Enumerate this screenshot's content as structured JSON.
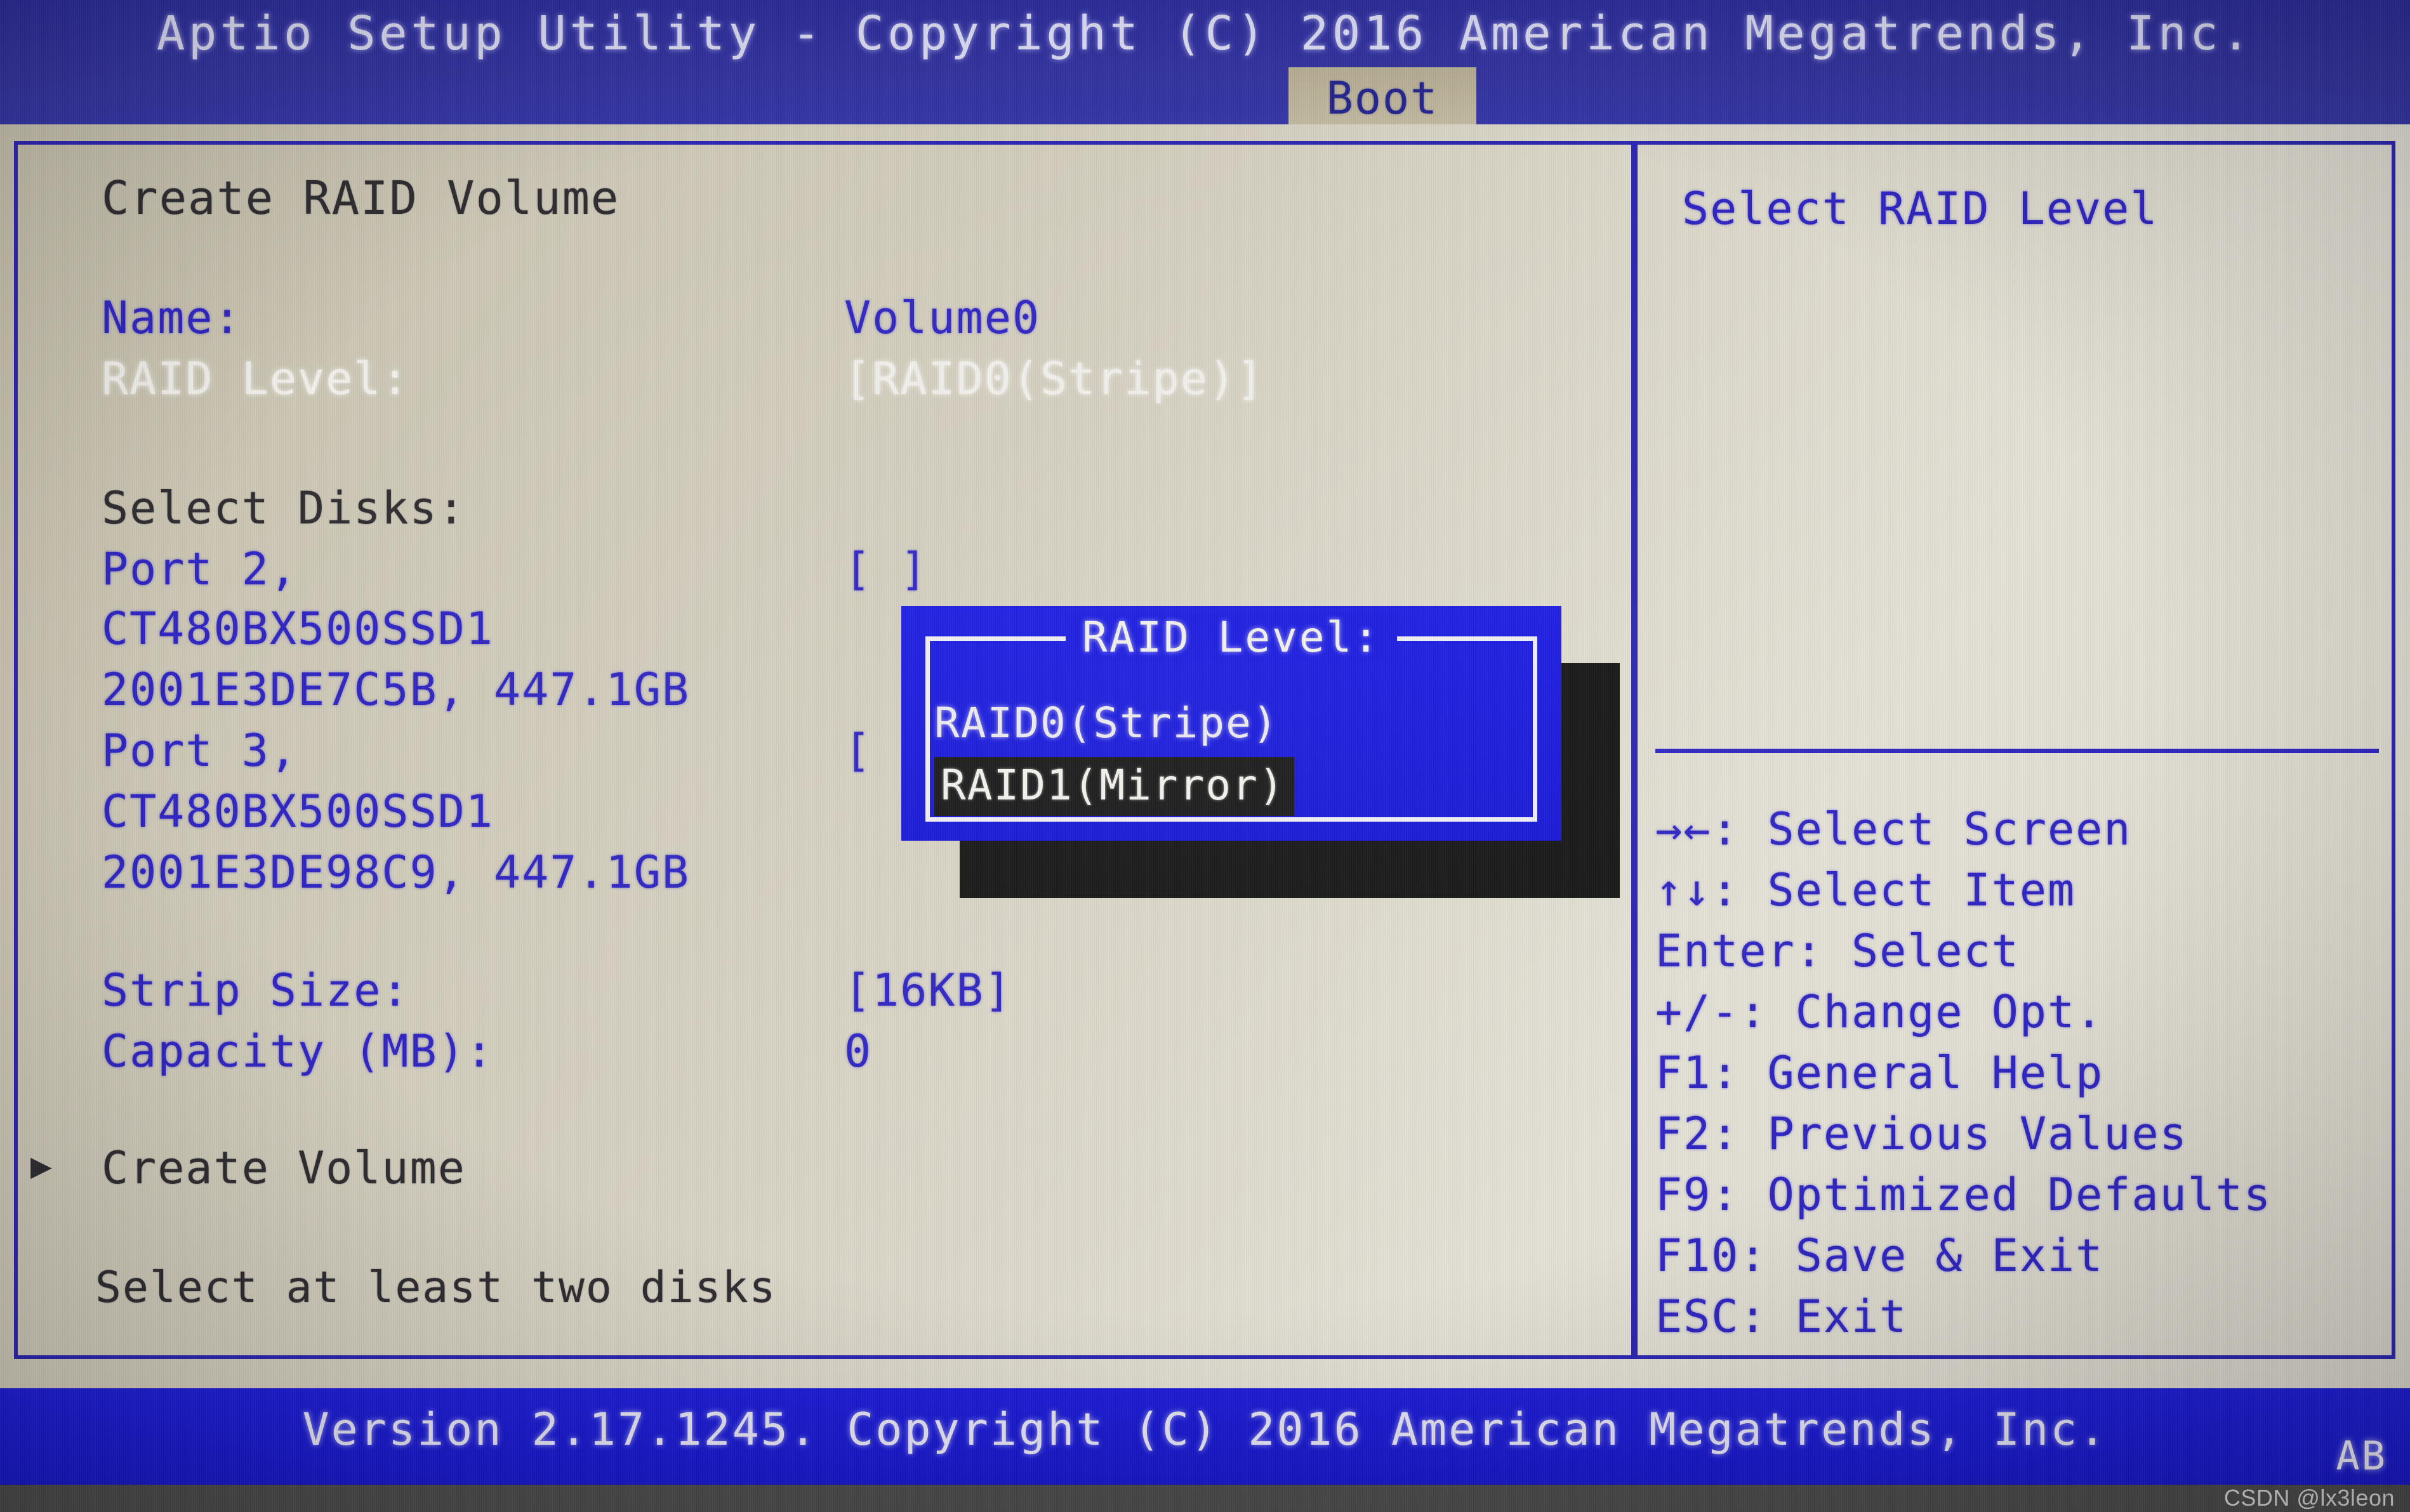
{
  "header": {
    "title": "Aptio Setup Utility - Copyright (C) 2016 American Megatrends, Inc.",
    "active_tab": "Boot"
  },
  "main": {
    "panel_title": "Create RAID Volume",
    "fields": {
      "name_label": "Name:",
      "name_value": "Volume0",
      "raid_level_label": "RAID Level:",
      "raid_level_value": "[RAID0(Stripe)]",
      "select_disks_label": "Select Disks:",
      "strip_size_label": "Strip Size:",
      "strip_size_value": "[16KB]",
      "capacity_label": "Capacity (MB):",
      "capacity_value": "0"
    },
    "disks": [
      {
        "port": "Port 2,",
        "model": "CT480BX500SSD1",
        "serial_and_size": "2001E3DE7C5B, 447.1GB",
        "checkbox": "[ ]"
      },
      {
        "port": "Port 3,",
        "model": "CT480BX500SSD1",
        "serial_and_size": "2001E3DE98C9, 447.1GB",
        "checkbox": "["
      }
    ],
    "create_volume_marker": "▶",
    "create_volume_label": "Create Volume",
    "hint": "Select at least two disks"
  },
  "dialog": {
    "title": "RAID Level:",
    "options": [
      "RAID0(Stripe)",
      "RAID1(Mirror)"
    ],
    "selected_index": 1
  },
  "help": {
    "description": "Select RAID Level",
    "keys": [
      "→←: Select Screen",
      "↑↓: Select Item",
      "Enter: Select",
      "+/-: Change Opt.",
      "F1: General Help",
      "F2: Previous Values",
      "F9: Optimized Defaults",
      "F10: Save & Exit",
      "ESC: Exit"
    ]
  },
  "footer": {
    "version": "Version 2.17.1245. Copyright (C) 2016 American Megatrends, Inc.",
    "corner_mark": "AB",
    "watermark": "CSDN @lx3leon"
  },
  "colors": {
    "header_bg": "#2a2a9e",
    "body_bg": "#cdc7b5",
    "frame_blue": "#2b24b4",
    "text_blue": "#2e24c4",
    "text_dark": "#2d2b30",
    "text_white": "#f4f2ee",
    "dialog_bg": "#1a1ae0",
    "highlight_bg": "#171717",
    "footer_bg": "#1b1bd6"
  }
}
